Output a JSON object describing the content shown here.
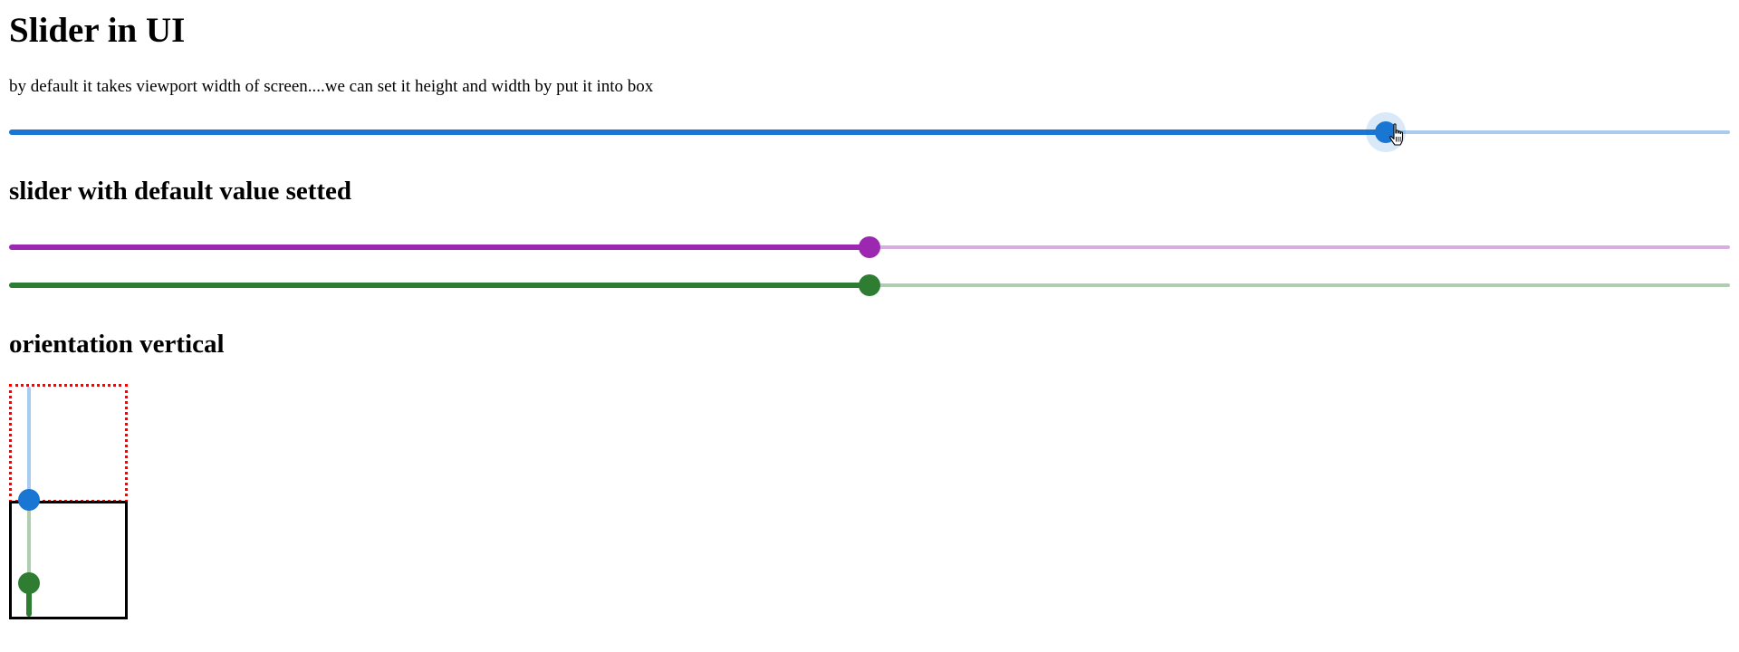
{
  "page": {
    "title": "Slider in UI",
    "description": "by default it takes viewport width of screen....we can set it height and width by put it into box",
    "default_value_heading": "slider with default value setted",
    "vertical_heading": "orientation vertical"
  },
  "colors": {
    "blue": "#1976d2",
    "purple": "#9c27b0",
    "green": "#2e7d32",
    "box_dotted_border": "#ff0000",
    "box_solid_border": "#000000"
  },
  "sliders": {
    "basic": {
      "value_fraction": 0.8,
      "color": "#1976d2",
      "state": "hover"
    },
    "purple": {
      "value_fraction": 0.5,
      "color": "#9c27b0"
    },
    "green": {
      "value_fraction": 0.5,
      "color": "#2e7d32"
    },
    "vertical_blue": {
      "value_fraction": 0.0,
      "color": "#1976d2",
      "orientation": "vertical"
    },
    "vertical_green": {
      "value_fraction": 0.3,
      "color": "#2e7d32",
      "orientation": "vertical"
    }
  },
  "icons": {
    "cursor": "hand-pointer-icon"
  }
}
